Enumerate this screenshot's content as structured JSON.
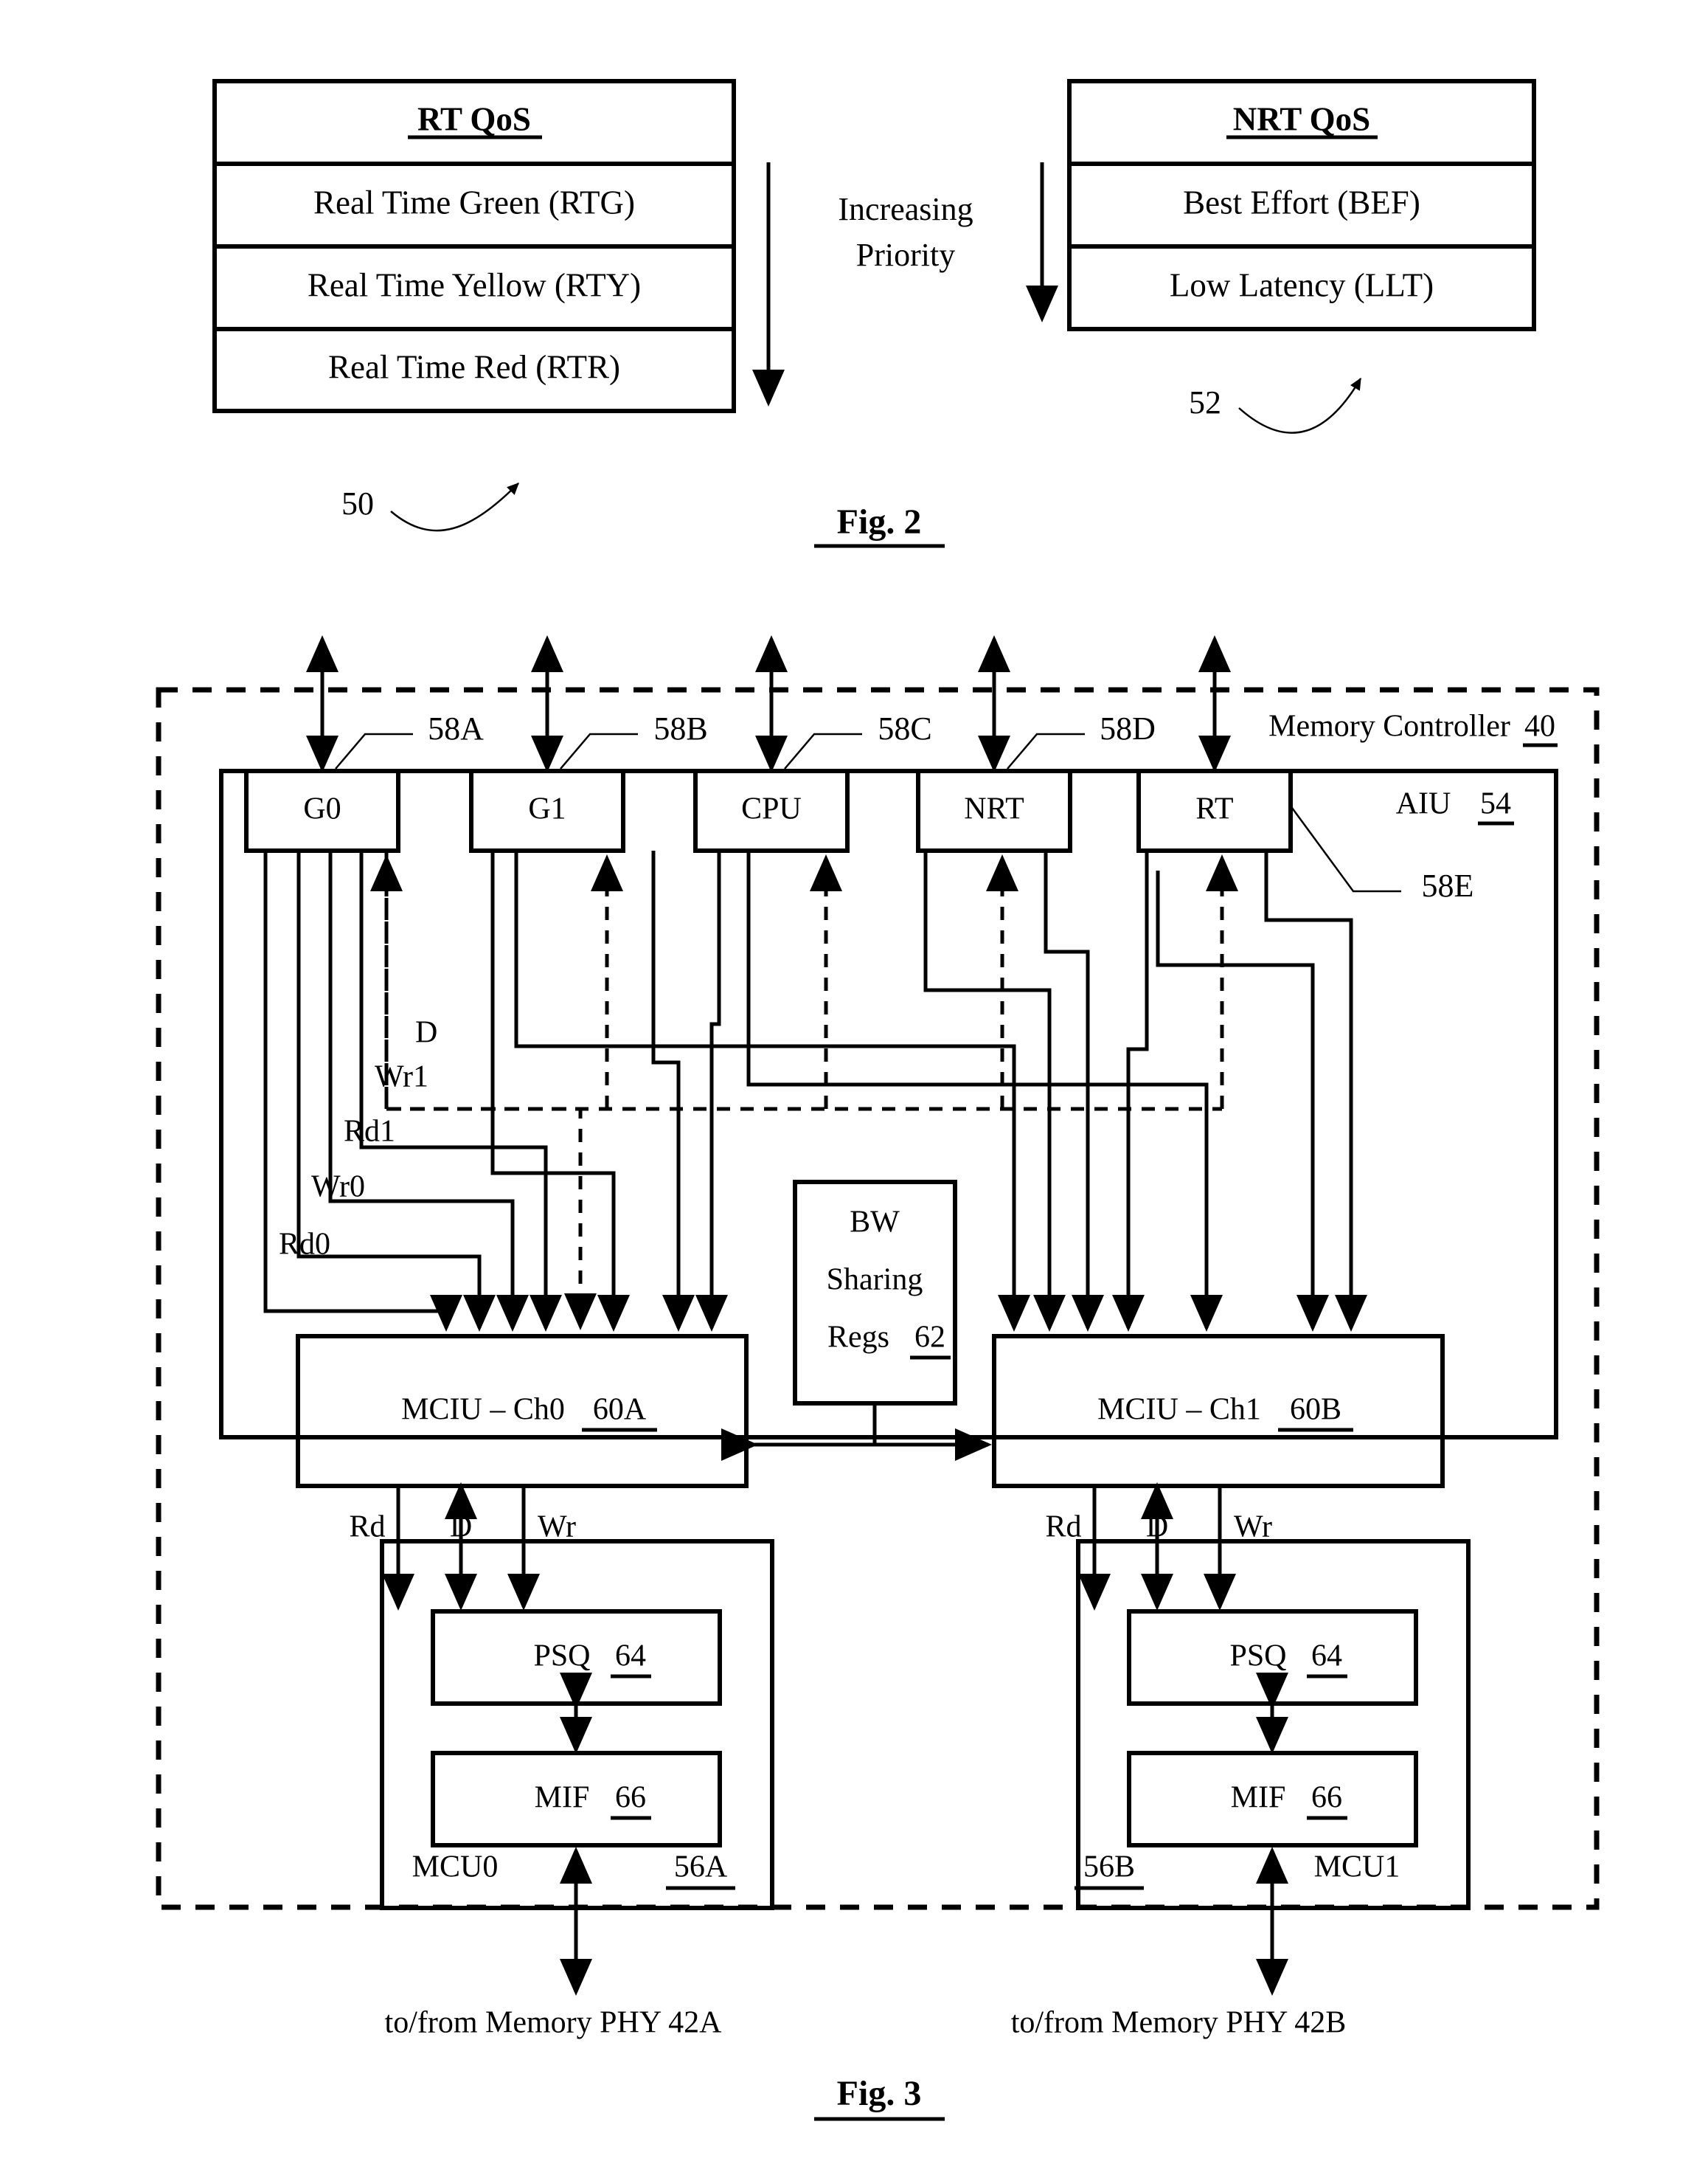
{
  "figure2": {
    "label": "Fig. 2",
    "left_table": {
      "ref": "50",
      "header": "RT QoS",
      "rows": [
        "Real Time Green (RTG)",
        "Real Time Yellow (RTY)",
        "Real Time Red (RTR)"
      ]
    },
    "right_table": {
      "ref": "52",
      "header": "NRT QoS",
      "rows": [
        "Best Effort (BEF)",
        "Low Latency (LLT)"
      ]
    },
    "priority_note": {
      "line1": "Increasing",
      "line2": "Priority"
    }
  },
  "figure3": {
    "label": "Fig. 3",
    "memory_controller": {
      "name": "Memory Controller",
      "ref": "40"
    },
    "aiu": {
      "name": "AIU",
      "ref": "54",
      "ports": [
        {
          "label": "G0",
          "ref": "58A"
        },
        {
          "label": "G1",
          "ref": "58B"
        },
        {
          "label": "CPU",
          "ref": "58C"
        },
        {
          "label": "NRT",
          "ref": "58D"
        },
        {
          "label": "RT",
          "ref": "58E"
        }
      ]
    },
    "signal_labels": [
      "D",
      "Wr1",
      "Rd1",
      "Wr0",
      "Rd0"
    ],
    "bw_sharing": {
      "line1": "BW",
      "line2": "Sharing",
      "line3": "Regs",
      "ref": "62"
    },
    "mciu": [
      {
        "label": "MCIU – Ch0",
        "ref": "60A"
      },
      {
        "label": "MCIU – Ch1",
        "ref": "60B"
      }
    ],
    "channel_port_labels": [
      "Rd",
      "D",
      "Wr"
    ],
    "mcu": [
      {
        "name": "MCU0",
        "ref": "56A",
        "psq": {
          "label": "PSQ",
          "ref": "64"
        },
        "mif": {
          "label": "MIF",
          "ref": "66"
        }
      },
      {
        "name": "MCU1",
        "ref": "56B",
        "psq": {
          "label": "PSQ",
          "ref": "64"
        },
        "mif": {
          "label": "MIF",
          "ref": "66"
        }
      }
    ],
    "phy_labels": [
      "to/from Memory PHY 42A",
      "to/from Memory PHY 42B"
    ]
  },
  "colors": {
    "ink": "#000000",
    "paper": "#ffffff"
  }
}
